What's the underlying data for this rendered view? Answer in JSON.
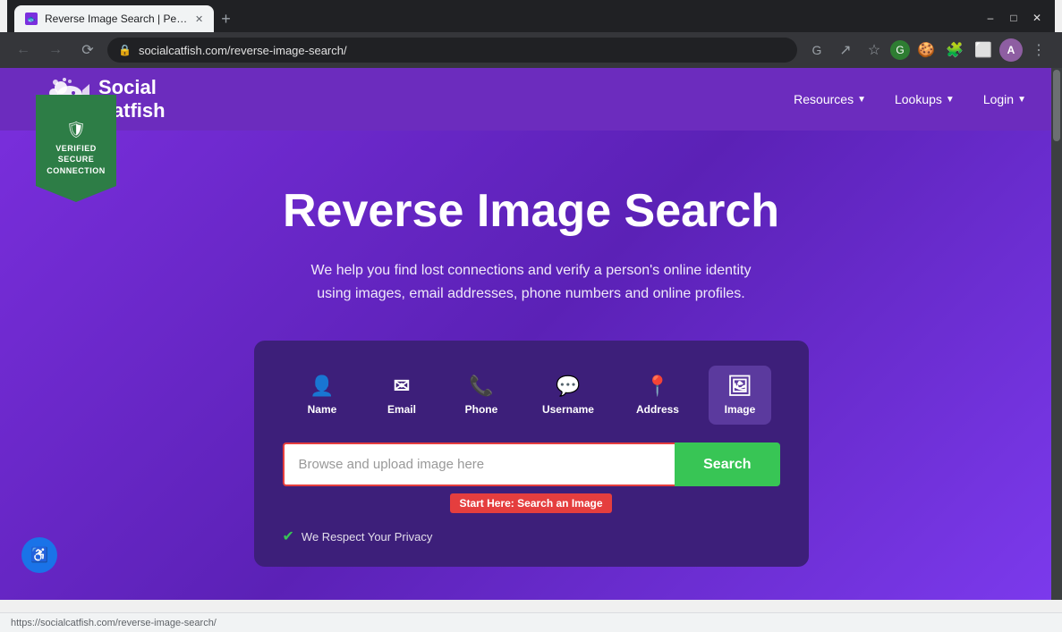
{
  "browser": {
    "tab_title": "Reverse Image Search | People S...",
    "tab_new_title": "+",
    "address": "socialcatfish.com/reverse-image-search/",
    "controls": {
      "minimize": "–",
      "maximize": "□",
      "close": "✕"
    }
  },
  "site": {
    "logo_text_line1": "Social",
    "logo_text_line2": "Catfish",
    "nav_resources": "Resources",
    "nav_lookups": "Lookups",
    "nav_login": "Login"
  },
  "verified_badge": {
    "line1": "VERIFIED",
    "line2": "SECURE",
    "line3": "CONNECTION"
  },
  "hero": {
    "title": "Reverse Image Search",
    "subtitle": "We help you find lost connections and verify a person's online identity using images, email addresses, phone numbers and online profiles."
  },
  "search_tabs": [
    {
      "id": "name",
      "label": "Name",
      "icon": "👤"
    },
    {
      "id": "email",
      "label": "Email",
      "icon": "✉"
    },
    {
      "id": "phone",
      "label": "Phone",
      "icon": "📞"
    },
    {
      "id": "username",
      "label": "Username",
      "icon": "💬"
    },
    {
      "id": "address",
      "label": "Address",
      "icon": "📍"
    },
    {
      "id": "image",
      "label": "Image",
      "icon": "🖼",
      "active": true
    }
  ],
  "search": {
    "placeholder": "Browse and upload image here",
    "hint": "Start Here: Search an Image",
    "button_label": "Search",
    "footer_text": "We Respect Your Privacy"
  },
  "status": {
    "url": "https://socialcatfish.com/reverse-image-search/"
  }
}
